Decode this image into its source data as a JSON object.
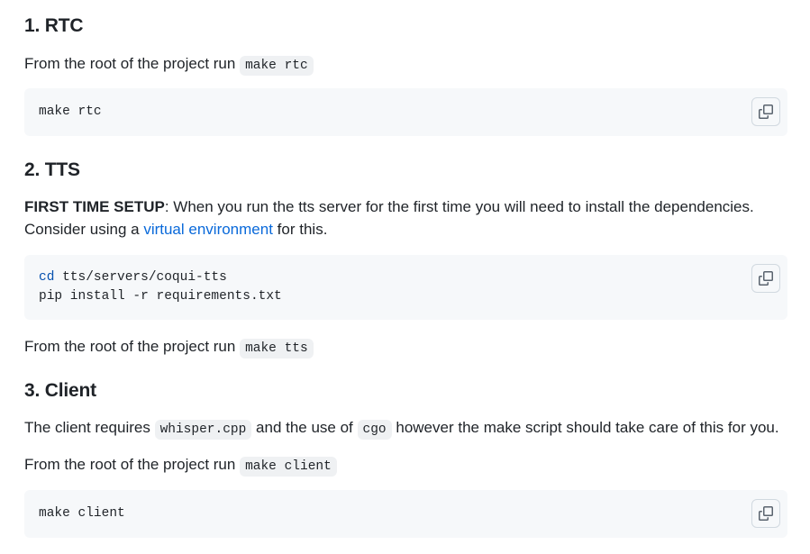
{
  "sections": {
    "rtc": {
      "heading": "1. RTC",
      "run_prefix": "From the root of the project run",
      "run_code": "make rtc",
      "code_block": "make rtc"
    },
    "tts": {
      "heading": "2. TTS",
      "setup_label": "FIRST TIME SETUP",
      "setup_text": ": When you run the tts server for the first time you will need to install the dependencies.",
      "consider_prefix": "Consider using a",
      "link_text": "virtual environment",
      "consider_suffix": "for this.",
      "code_cmd": "cd",
      "code_line1_rest": " tts/servers/coqui-tts",
      "code_line2": "pip install -r requirements.txt",
      "run_prefix": "From the root of the project run",
      "run_code": "make tts"
    },
    "client": {
      "heading": "3. Client",
      "req_prefix": "The client requires",
      "req_code1": "whisper.cpp",
      "req_mid": "and the use of",
      "req_code2": "cgo",
      "req_suffix": "however the make script should take care of this for you.",
      "run_prefix": "From the root of the project run",
      "run_code": "make client",
      "code_block": "make client"
    }
  },
  "colors": {
    "link": "#0969da",
    "code_bg": "#f6f8fa",
    "keyword": "#0550ae"
  },
  "icons": {
    "copy": "copy-icon"
  }
}
